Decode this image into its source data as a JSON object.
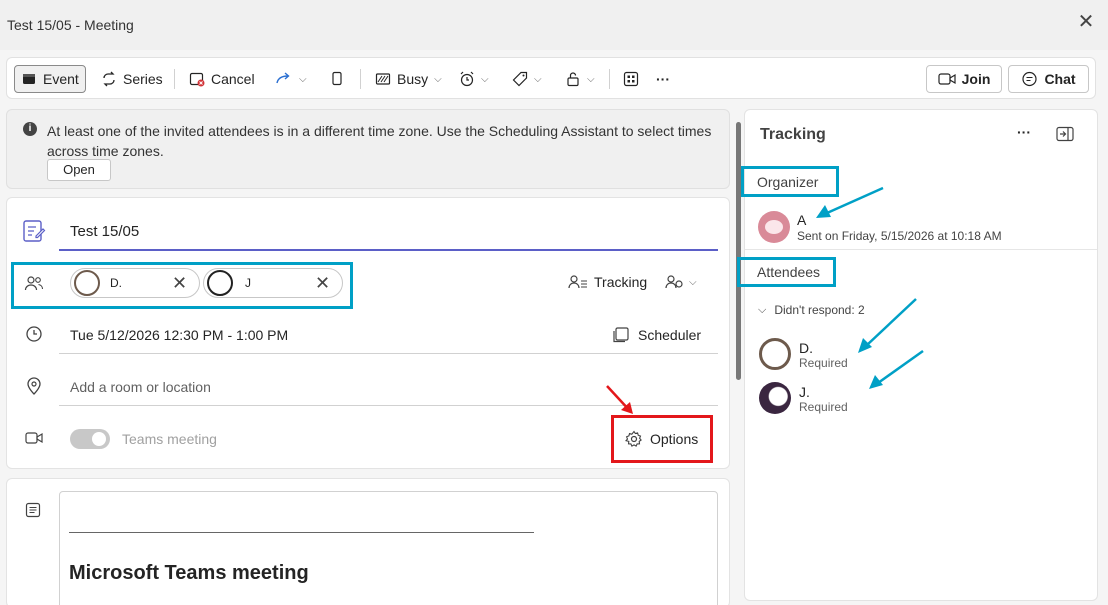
{
  "window": {
    "title": "Test 15/05 - Meeting"
  },
  "toolbar": {
    "event_label": "Event",
    "series_label": "Series",
    "cancel_label": "Cancel",
    "busy_label": "Busy",
    "join_label": "Join",
    "chat_label": "Chat"
  },
  "banner": {
    "text": "At least one of the invited attendees is in a different time zone. Use the Scheduling Assistant to select times across time zones.",
    "open_label": "Open"
  },
  "form": {
    "title_value": "Test 15/05",
    "attendees": [
      {
        "name": "D."
      },
      {
        "name": "J"
      }
    ],
    "tracking_label": "Tracking",
    "datetime": "Tue 5/12/2026 12:30 PM - 1:00 PM",
    "scheduler_label": "Scheduler",
    "location_placeholder": "Add a room or location",
    "teams_label": "Teams meeting",
    "options_label": "Options"
  },
  "description": {
    "heading": "Microsoft Teams meeting"
  },
  "tracking_panel": {
    "title": "Tracking",
    "organizer_heading": "Organizer",
    "organizer_name": "A",
    "organizer_sent": "Sent on Friday, 5/15/2026 at 10:18 AM",
    "attendees_heading": "Attendees",
    "group_label": "Didn't respond: 2",
    "attendees": [
      {
        "name": "D.",
        "role": "Required"
      },
      {
        "name": "J.",
        "role": "Required"
      }
    ]
  },
  "colors": {
    "highlight_cyan": "#00a0c6",
    "highlight_red": "#e3171b",
    "accent": "#5b5fc7"
  }
}
